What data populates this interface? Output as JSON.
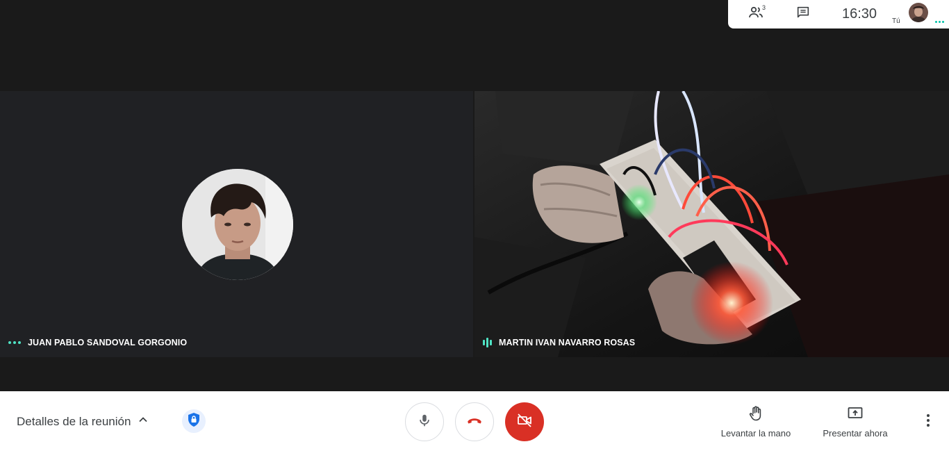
{
  "top_bar": {
    "participant_count": "3",
    "time": "16:30",
    "self_label": "Tú"
  },
  "participants": [
    {
      "name": "JUAN PABLO SANDOVAL GORGONIO"
    },
    {
      "name": "MARTIN IVAN NAVARRO ROSAS"
    }
  ],
  "bottom_bar": {
    "meeting_details": "Detalles de la reunión",
    "raise_hand": "Levantar la mano",
    "present_now": "Presentar ahora"
  },
  "icons": {
    "people": "people-icon",
    "chat": "chat-icon",
    "chevron": "chevron-up-icon",
    "shield": "lock-shield-icon",
    "mic": "mic-icon",
    "hangup": "phone-hangup-icon",
    "camera_off": "camera-off-icon",
    "hand": "hand-icon",
    "present": "present-screen-icon",
    "more": "more-vert-icon"
  },
  "colors": {
    "accent_teal": "#4fe3c4",
    "danger_red": "#d93025",
    "shield_blue": "#1a73e8"
  }
}
